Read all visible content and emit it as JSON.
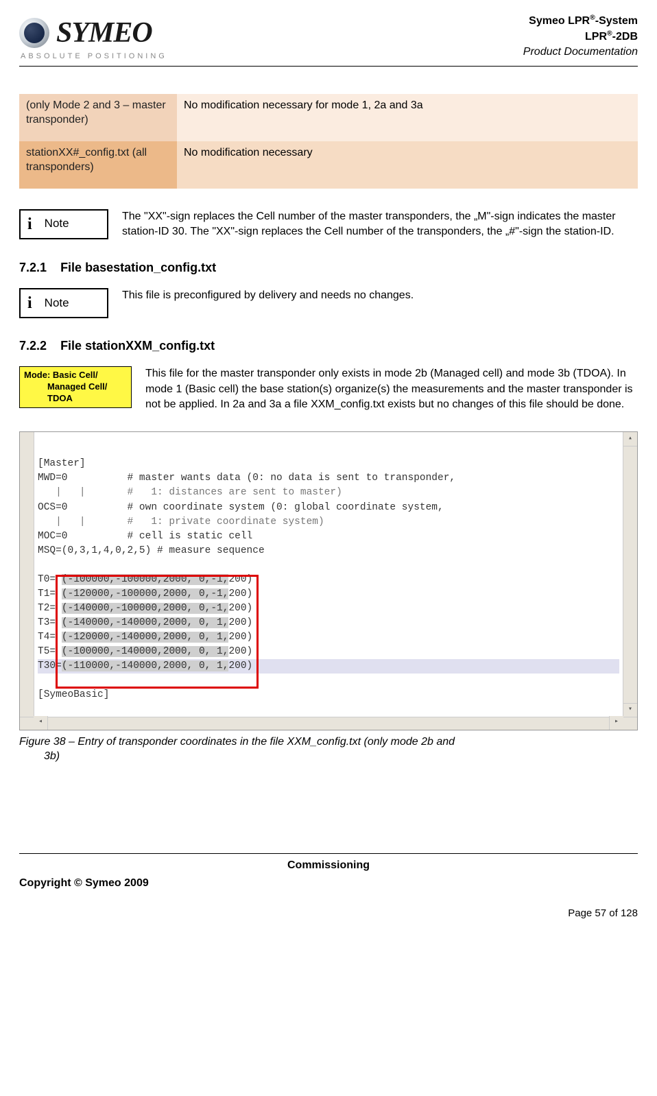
{
  "header": {
    "logo_main": "SYMEO",
    "logo_sub": "ABSOLUTE POSITIONING",
    "right_line1a": "Symeo LPR",
    "right_line1b": "-System",
    "right_line2a": "LPR",
    "right_line2b": "-2DB",
    "right_line3": "Product Documentation",
    "sup": "®"
  },
  "table": {
    "r1c1": "(only Mode 2 and 3 – master transponder)",
    "r1c2": "No modification necessary for mode 1, 2a and 3a",
    "r2c1": "stationXX#_config.txt (all transponders)",
    "r2c2": "No modification necessary"
  },
  "note1": {
    "label": "Note",
    "text": "The \"XX\"-sign replaces the Cell number of the master transponders, the „M\"-sign indicates the master station-ID 30. The \"XX\"-sign replaces the Cell number of the transponders, the „#\"-sign the station-ID."
  },
  "sec721": {
    "num": "7.2.1",
    "title": "File basestation_config.txt"
  },
  "note2": {
    "label": "Note",
    "text": "This file is preconfigured by delivery and needs no changes."
  },
  "sec722": {
    "num": "7.2.2",
    "title": "File stationXXM_config.txt"
  },
  "modebadge": {
    "line1": "Mode: Basic Cell/",
    "line2": "Managed Cell/",
    "line3": "TDOA"
  },
  "para722": "This file for the master transponder only exists in mode 2b (Managed cell) and mode 3b (TDOA). In mode 1 (Basic cell) the base station(s) organize(s) the measurements and the master transponder is not be applied. In 2a and 3a a file XXM_config.txt exists but no changes of this file should be done.",
  "editor": {
    "l01": "[Master]",
    "l02a": "MWD=0          # master wants data (0: no data is sent to transponder,",
    "l03a": "   |   |       #   1: distances are sent to master)",
    "l04a": "OCS=0          # own coordinate system (0: global coordinate system,",
    "l05a": "   |   |       #   1: private coordinate system)",
    "l06a": "MOC=0          # cell is static cell",
    "l07a": "MSQ=(0,3,1,4,0,2,5) # measure sequence",
    "t0p": "T0= ",
    "t0s": "(-100000,-100000,2000, 0,-1,",
    "t0e": "200)",
    "t1p": "T1= ",
    "t1s": "(-120000,-100000,2000, 0,-1,",
    "t1e": "200)",
    "t2p": "T2= ",
    "t2s": "(-140000,-100000,2000, 0,-1,",
    "t2e": "200)",
    "t3p": "T3= ",
    "t3s": "(-140000,-140000,2000, 0, 1,",
    "t3e": "200)",
    "t4p": "T4= ",
    "t4s": "(-120000,-140000,2000, 0, 1,",
    "t4e": "200)",
    "t5p": "T5= ",
    "t5s": "(-100000,-140000,2000, 0, 1,",
    "t5e": "200)",
    "t30p": "T30=",
    "t30s": "(-110000,-140000,2000, 0, 1,",
    "t30e": "200)",
    "l16": "[SymeoBasic]"
  },
  "figcap": {
    "line1": "Figure 38 – Entry of transponder coordinates in the file XXM_config.txt (only mode 2b and",
    "line2": "3b)"
  },
  "footer": {
    "center": "Commissioning",
    "left": "Copyright © Symeo 2009",
    "page": "Page 57 of 128"
  }
}
